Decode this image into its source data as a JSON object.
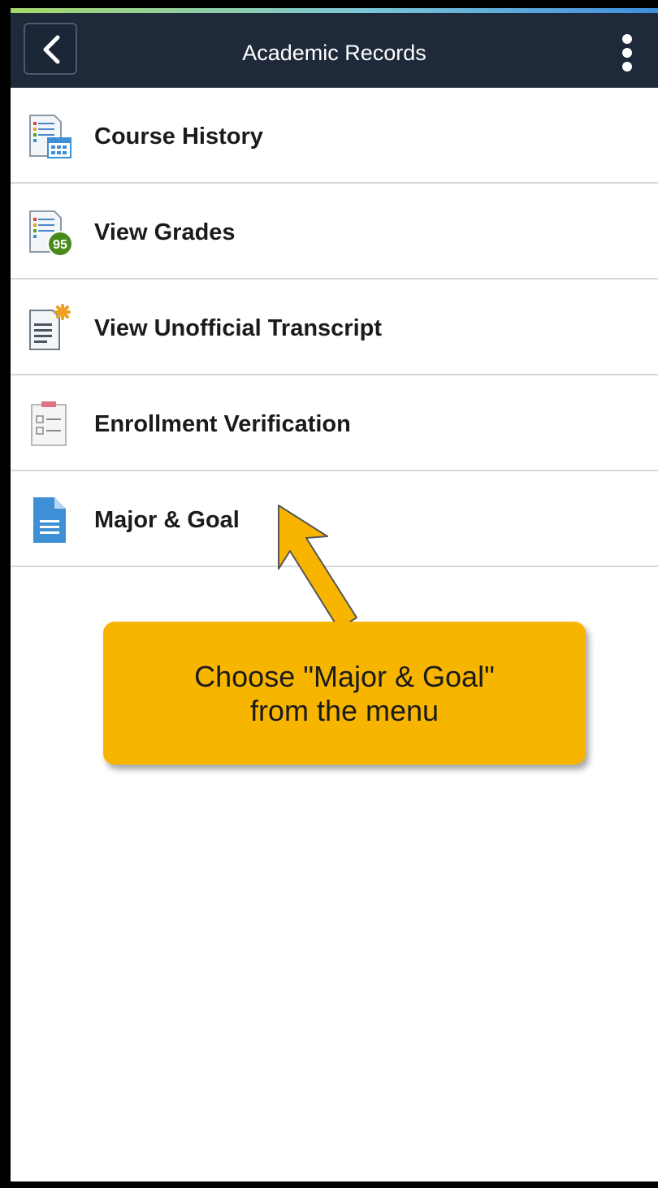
{
  "header": {
    "title": "Academic Records",
    "back_icon": "chevron-left-icon",
    "menu_icon": "kebab-menu-icon"
  },
  "menu": {
    "items": [
      {
        "label": "Course History",
        "icon": "course-history-icon"
      },
      {
        "label": "View Grades",
        "icon": "view-grades-icon",
        "badge": "95"
      },
      {
        "label": "View Unofficial Transcript",
        "icon": "transcript-icon"
      },
      {
        "label": "Enrollment Verification",
        "icon": "enrollment-verification-icon"
      },
      {
        "label": "Major & Goal",
        "icon": "document-icon"
      }
    ]
  },
  "callout": {
    "line1": "Choose \"Major & Goal\"",
    "line2": "from the menu"
  },
  "colors": {
    "header_bg": "#1e2a3a",
    "callout_bg": "#f7b500",
    "badge_green": "#4a8a1c",
    "document_blue": "#3d8fd6"
  }
}
